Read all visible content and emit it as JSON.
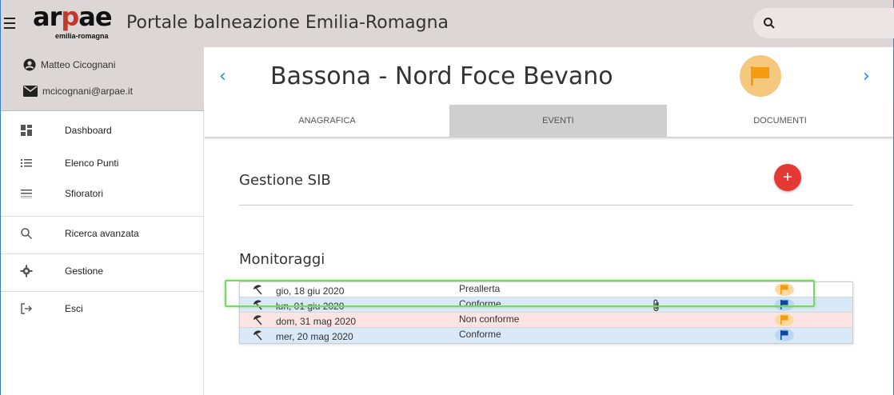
{
  "topbar": {
    "logo_text": "arpae",
    "logo_sub": "emilia-romagna",
    "app_title": "Portale balneazione Emilia-Romagna"
  },
  "user": {
    "name": "Matteo Cicognani",
    "email": "mcicognani@arpae.it"
  },
  "sidebar": {
    "items": [
      {
        "label": "Dashboard",
        "icon": "dashboard-icon"
      },
      {
        "label": "Elenco Punti",
        "icon": "list-icon"
      },
      {
        "label": "Sfioratori",
        "icon": "sfioratori-icon"
      },
      {
        "label": "Ricerca avanzata",
        "icon": "search-icon"
      },
      {
        "label": "Gestione",
        "icon": "gear-icon"
      },
      {
        "label": "Esci",
        "icon": "logout-icon"
      }
    ]
  },
  "main": {
    "place_title": "Bassona - Nord Foce Bevano",
    "tabs": [
      {
        "label": "ANAGRAFICA"
      },
      {
        "label": "EVENTI"
      },
      {
        "label": "DOCUMENTI"
      }
    ],
    "active_tab": "EVENTI",
    "gestione_title": "Gestione SIB",
    "monitoraggi_title": "Monitoraggi",
    "add_label": "+",
    "rows": [
      {
        "date": "gio, 18 giu 2020",
        "status": "Preallerta",
        "flag_color": "#f39c12",
        "row_color": "white",
        "attachment": false
      },
      {
        "date": "lun, 01 giu 2020",
        "status": "Conforme",
        "flag_color": "#0d47a1",
        "row_color": "blue",
        "attachment": true
      },
      {
        "date": "dom, 31 mag 2020",
        "status": "Non conforme",
        "flag_color": "#f39c12",
        "row_color": "pink",
        "attachment": false
      },
      {
        "date": "mer, 20 mag 2020",
        "status": "Conforme",
        "flag_color": "#0d47a1",
        "row_color": "blue",
        "attachment": false
      }
    ]
  },
  "colors": {
    "header_bg": "#ddd6d6",
    "accent_blue": "#1e88e5",
    "fab_red": "#e53935",
    "flag_orange": "#f39c12",
    "highlight_green": "#7ed36b"
  }
}
